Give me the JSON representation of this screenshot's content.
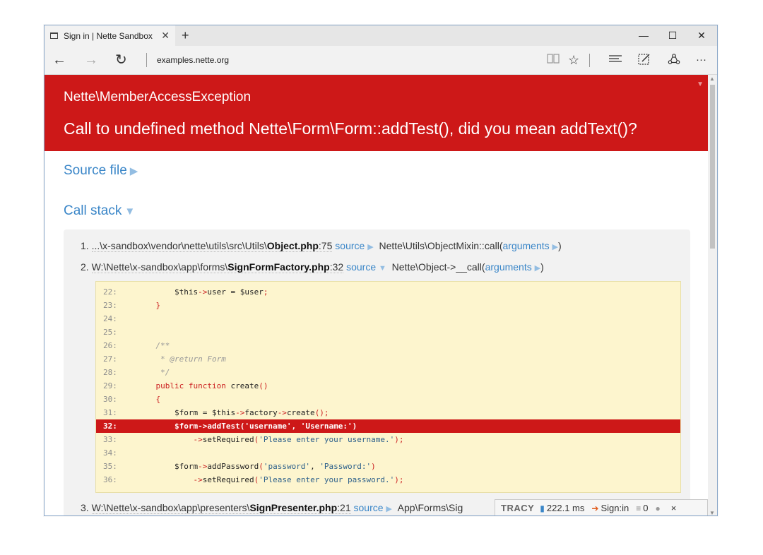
{
  "browser": {
    "tab_title": "Sign in | Nette Sandbox",
    "tab_close": "✕",
    "new_tab": "+",
    "minimize": "—",
    "maximize": "☐",
    "close": "✕",
    "back": "←",
    "forward": "→",
    "refresh": "↻",
    "url": "examples.nette.org",
    "more": "···"
  },
  "error": {
    "exception_class": "Nette\\MemberAccessException",
    "message": "Call to undefined method Nette\\Form\\Form::addTest(), did you mean addText()?"
  },
  "sections": {
    "source_file": "Source file",
    "call_stack": "Call stack"
  },
  "stack": [
    {
      "index": "1.",
      "path_prefix": "...\\x-sandbox\\vendor\\nette\\utils\\src\\Utils\\",
      "file": "Object.php",
      "line": ":75",
      "source_label": "source",
      "call": "Nette\\Utils\\ObjectMixin::call(",
      "args_label": "arguments",
      "call_end": ")"
    },
    {
      "index": "2.",
      "path_prefix": "W:\\Nette\\x-sandbox\\app\\forms\\",
      "file": "SignFormFactory.php",
      "line": ":32",
      "source_label": "source",
      "call": "Nette\\Object->__call(",
      "args_label": "arguments",
      "call_end": ")"
    },
    {
      "index": "3.",
      "path_prefix": "W:\\Nette\\x-sandbox\\app\\presenters\\",
      "file": "SignPresenter.php",
      "line": ":21",
      "source_label": "source",
      "call": "App\\Forms\\Sig"
    }
  ],
  "code": [
    {
      "n": "22:",
      "t": "        $this->user = $user;"
    },
    {
      "n": "23:",
      "t": "    }"
    },
    {
      "n": "24:",
      "t": ""
    },
    {
      "n": "25:",
      "t": ""
    },
    {
      "n": "26:",
      "t": "    /**"
    },
    {
      "n": "27:",
      "t": "     * @return Form"
    },
    {
      "n": "28:",
      "t": "     */"
    },
    {
      "n": "29:",
      "t": "    public function create()"
    },
    {
      "n": "30:",
      "t": "    {"
    },
    {
      "n": "31:",
      "t": "        $form = $this->factory->create();"
    },
    {
      "n": "32:",
      "t": "        $form->addTest('username', 'Username:')"
    },
    {
      "n": "33:",
      "t": "            ->setRequired('Please enter your username.');"
    },
    {
      "n": "34:",
      "t": ""
    },
    {
      "n": "35:",
      "t": "        $form->addPassword('password', 'Password:')"
    },
    {
      "n": "36:",
      "t": "            ->setRequired('Please enter your password.');"
    }
  ],
  "tracy": {
    "logo": "TRACY",
    "time": "222.1 ms",
    "presenter": "Sign:in",
    "queries": "0",
    "close": "×"
  }
}
